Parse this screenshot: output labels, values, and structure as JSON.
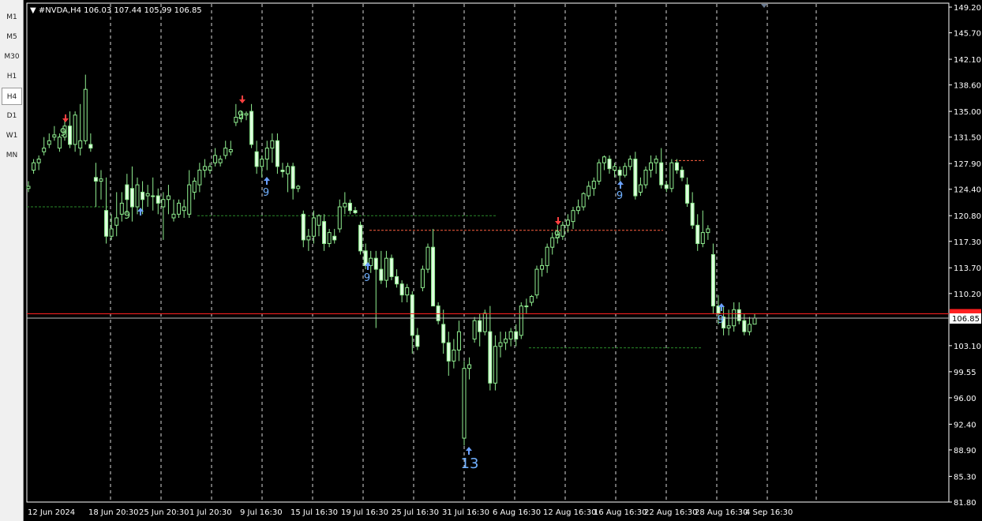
{
  "timeframes": [
    "M1",
    "M5",
    "M30",
    "H1",
    "H4",
    "D1",
    "W1",
    "MN"
  ],
  "active_timeframe": "H4",
  "header": {
    "text": "#NVDA,H4  106.03 107.44 105.99 106.85"
  },
  "chart_data": {
    "type": "candlestick",
    "symbol": "#NVDA",
    "timeframe": "H4",
    "ohlc_last": {
      "open": 106.03,
      "high": 107.44,
      "low": 105.99,
      "close": 106.85
    },
    "ylim": [
      81.8,
      149.2
    ],
    "y_ticks": [
      "149.20",
      "145.70",
      "142.10",
      "138.60",
      "135.00",
      "131.50",
      "127.90",
      "124.40",
      "120.80",
      "117.30",
      "113.70",
      "110.20",
      "103.10",
      "99.55",
      "96.00",
      "92.40",
      "88.90",
      "85.30",
      "81.80"
    ],
    "x_tick_labels": [
      "12 Jun 2024",
      "18 Jun 20:30",
      "25 Jun 20:30",
      "1 Jul 20:30",
      "9 Jul 16:30",
      "15 Jul 16:30",
      "19 Jul 16:30",
      "25 Jul 16:30",
      "31 Jul 16:30",
      "6 Aug 16:30",
      "12 Aug 16:30",
      "16 Aug 16:30",
      "22 Aug 16:30",
      "28 Aug 16:30",
      "4 Sep 16:30"
    ],
    "current_price_label": "106.85",
    "current_price": 106.85,
    "red_line_price": 107.44,
    "grid": "vertical dashed",
    "colors": {
      "bg": "#000000",
      "up": "#ffffff",
      "down": "#90ee90",
      "bull_body": "#e0ffe0",
      "axis": "#ffffff",
      "red_line": "#ff2020",
      "resistance": "#ff6040",
      "support": "#2a8a2a",
      "arrow_up": "#6aa0ff",
      "arrow_down": "#ff4040",
      "count_up": "#70b0ff"
    },
    "candles": [
      [
        124.5,
        125.5,
        124.0,
        124.8
      ],
      [
        127.0,
        128.5,
        126.5,
        128.0
      ],
      [
        128.0,
        129.0,
        127.0,
        128.5
      ],
      [
        129.5,
        131.5,
        129.0,
        130.0
      ],
      [
        130.5,
        132.0,
        130.0,
        131.0
      ],
      [
        131.5,
        133.0,
        131.0,
        131.8
      ],
      [
        130.0,
        132.0,
        129.5,
        131.5
      ],
      [
        131.5,
        134.0,
        131.0,
        133.0
      ],
      [
        133.0,
        135.0,
        130.0,
        130.5
      ],
      [
        130.5,
        135.0,
        129.5,
        134.5
      ],
      [
        130.0,
        136.0,
        129.0,
        131.0
      ],
      [
        131.0,
        140.0,
        130.5,
        138.0
      ],
      [
        130.5,
        132.0,
        129.5,
        130.0
      ],
      [
        126.0,
        128.0,
        122.0,
        125.5
      ],
      [
        125.5,
        127.0,
        123.0,
        125.8
      ],
      [
        121.5,
        126.0,
        117.0,
        118.0
      ],
      [
        118.0,
        121.0,
        117.5,
        119.0
      ],
      [
        119.5,
        124.0,
        118.0,
        120.5
      ],
      [
        121.0,
        124.0,
        120.0,
        122.5
      ],
      [
        125.0,
        126.5,
        121.0,
        123.0
      ],
      [
        124.5,
        127.5,
        120.0,
        122.0
      ],
      [
        122.0,
        126.0,
        121.0,
        125.0
      ],
      [
        124.0,
        125.5,
        121.0,
        123.0
      ],
      [
        123.5,
        125.0,
        122.0,
        123.8
      ],
      [
        123.5,
        126.0,
        121.5,
        123.5
      ],
      [
        123.5,
        124.5,
        121.0,
        122.5
      ],
      [
        122.0,
        124.0,
        117.5,
        123.0
      ],
      [
        123.0,
        125.0,
        121.0,
        123.5
      ],
      [
        120.5,
        123.0,
        120.0,
        121.0
      ],
      [
        121.0,
        123.0,
        120.5,
        122.5
      ],
      [
        121.5,
        123.0,
        120.5,
        122.0
      ],
      [
        121.0,
        127.0,
        120.5,
        125.0
      ],
      [
        124.0,
        126.0,
        123.0,
        125.5
      ],
      [
        125.0,
        128.0,
        124.0,
        127.0
      ],
      [
        127.0,
        128.5,
        126.0,
        127.5
      ],
      [
        127.0,
        128.0,
        126.5,
        127.5
      ],
      [
        128.0,
        130.0,
        127.5,
        129.0
      ],
      [
        128.0,
        129.0,
        127.5,
        128.5
      ],
      [
        129.0,
        131.0,
        128.5,
        130.0
      ],
      [
        129.5,
        131.0,
        129.0,
        129.8
      ],
      [
        133.5,
        136.0,
        133.0,
        134.2
      ],
      [
        134.0,
        135.0,
        133.5,
        134.5
      ],
      [
        134.5,
        135.0,
        133.8,
        134.7
      ],
      [
        135.0,
        136.0,
        130.0,
        130.5
      ],
      [
        129.5,
        131.0,
        126.5,
        127.5
      ],
      [
        127.5,
        129.0,
        126.0,
        128.5
      ],
      [
        128.5,
        131.0,
        127.0,
        130.0
      ],
      [
        130.0,
        132.0,
        128.0,
        131.0
      ],
      [
        131.0,
        132.0,
        126.5,
        127.5
      ],
      [
        127.0,
        128.0,
        126.0,
        126.8
      ],
      [
        126.5,
        128.0,
        124.0,
        127.5
      ],
      [
        127.5,
        128.0,
        123.0,
        124.5
      ],
      [
        124.5,
        125.0,
        124.0,
        124.8
      ],
      [
        121.0,
        121.5,
        116.5,
        117.5
      ],
      [
        117.5,
        119.0,
        116.0,
        118.0
      ],
      [
        118.0,
        121.5,
        117.0,
        120.5
      ],
      [
        119.5,
        121.0,
        118.0,
        120.8
      ],
      [
        120.0,
        121.0,
        116.0,
        117.0
      ],
      [
        117.0,
        119.0,
        116.5,
        118.5
      ],
      [
        118.0,
        119.0,
        117.0,
        117.5
      ],
      [
        119.0,
        123.0,
        118.5,
        122.0
      ],
      [
        122.0,
        124.0,
        121.0,
        122.5
      ],
      [
        122.5,
        123.0,
        121.0,
        121.5
      ],
      [
        121.5,
        122.0,
        121.0,
        121.2
      ],
      [
        119.5,
        120.0,
        115.5,
        116.0
      ],
      [
        116.0,
        117.0,
        113.5,
        114.0
      ],
      [
        114.0,
        116.0,
        113.0,
        115.0
      ],
      [
        115.0,
        116.0,
        105.5,
        113.5
      ],
      [
        113.5,
        116.0,
        111.5,
        112.0
      ],
      [
        112.0,
        116.0,
        111.0,
        115.0
      ],
      [
        115.0,
        115.5,
        112.0,
        112.5
      ],
      [
        112.5,
        113.5,
        111.0,
        111.5
      ],
      [
        111.5,
        112.0,
        109.0,
        110.0
      ],
      [
        110.0,
        111.5,
        109.0,
        111.0
      ],
      [
        110.0,
        110.5,
        102.0,
        104.5
      ],
      [
        104.5,
        105.5,
        102.5,
        103.0
      ],
      [
        111.0,
        114.0,
        110.5,
        113.5
      ],
      [
        113.5,
        117.0,
        113.0,
        116.5
      ],
      [
        116.5,
        119.0,
        115.5,
        108.5
      ],
      [
        108.5,
        109.0,
        106.0,
        106.5
      ],
      [
        106.0,
        108.0,
        102.0,
        103.5
      ],
      [
        103.5,
        105.0,
        99.0,
        101.0
      ],
      [
        101.0,
        104.0,
        100.0,
        102.5
      ],
      [
        102.5,
        106.5,
        101.0,
        105.0
      ],
      [
        90.5,
        101.0,
        89.5,
        100.0
      ],
      [
        100.0,
        101.5,
        98.5,
        100.5
      ],
      [
        104.0,
        107.0,
        103.5,
        106.5
      ],
      [
        106.5,
        107.5,
        103.0,
        105.0
      ],
      [
        105.0,
        108.0,
        104.5,
        107.5
      ],
      [
        105.0,
        108.5,
        97.0,
        98.0
      ],
      [
        98.0,
        104.5,
        97.0,
        103.0
      ],
      [
        103.0,
        105.0,
        101.5,
        103.5
      ],
      [
        103.5,
        105.0,
        102.5,
        104.0
      ],
      [
        104.0,
        105.5,
        103.0,
        105.0
      ],
      [
        105.0,
        106.0,
        103.0,
        104.0
      ],
      [
        104.5,
        109.0,
        104.0,
        108.5
      ],
      [
        108.5,
        109.5,
        107.5,
        108.5
      ],
      [
        109.0,
        110.0,
        108.5,
        109.8
      ],
      [
        110.0,
        114.0,
        109.5,
        113.5
      ],
      [
        113.5,
        115.0,
        112.5,
        114.0
      ],
      [
        114.0,
        117.0,
        113.0,
        116.5
      ],
      [
        116.5,
        118.5,
        115.5,
        117.8
      ],
      [
        117.8,
        119.5,
        117.0,
        118.2
      ],
      [
        118.0,
        120.0,
        117.5,
        119.5
      ],
      [
        119.5,
        121.0,
        118.5,
        120.2
      ],
      [
        120.0,
        122.0,
        119.0,
        121.5
      ],
      [
        121.5,
        123.0,
        121.0,
        122.0
      ],
      [
        122.0,
        124.0,
        121.5,
        123.8
      ],
      [
        123.5,
        125.5,
        123.0,
        124.8
      ],
      [
        124.5,
        126.0,
        123.5,
        125.5
      ],
      [
        125.5,
        128.5,
        125.0,
        128.0
      ],
      [
        128.0,
        129.0,
        127.0,
        128.8
      ],
      [
        128.5,
        129.0,
        126.5,
        127.2
      ],
      [
        127.0,
        128.0,
        126.0,
        127.5
      ],
      [
        127.0,
        127.5,
        125.5,
        126.3
      ],
      [
        126.3,
        128.0,
        126.0,
        127.5
      ],
      [
        127.5,
        129.0,
        127.0,
        128.5
      ],
      [
        128.5,
        129.5,
        123.0,
        123.5
      ],
      [
        124.0,
        126.0,
        123.5,
        125.0
      ],
      [
        125.0,
        127.5,
        124.5,
        127.0
      ],
      [
        127.0,
        129.0,
        126.0,
        128.0
      ],
      [
        128.0,
        129.0,
        126.5,
        128.5
      ],
      [
        128.0,
        130.0,
        124.5,
        125.0
      ],
      [
        125.0,
        125.5,
        124.0,
        124.5
      ],
      [
        124.5,
        128.5,
        124.0,
        128.0
      ],
      [
        128.0,
        128.5,
        126.5,
        127.0
      ],
      [
        127.0,
        127.5,
        125.5,
        126.0
      ],
      [
        125.0,
        126.0,
        122.0,
        122.5
      ],
      [
        122.5,
        124.0,
        119.0,
        119.5
      ],
      [
        119.5,
        121.0,
        116.0,
        117.0
      ],
      [
        117.0,
        121.5,
        116.5,
        118.5
      ],
      [
        118.5,
        119.5,
        117.5,
        119.0
      ],
      [
        115.5,
        117.0,
        107.5,
        108.5
      ],
      [
        108.5,
        110.0,
        106.0,
        107.5
      ],
      [
        107.0,
        108.5,
        104.5,
        105.5
      ],
      [
        105.5,
        108.0,
        104.5,
        105.8
      ],
      [
        105.8,
        109.0,
        105.0,
        108.0
      ],
      [
        108.0,
        109.0,
        106.0,
        106.5
      ],
      [
        106.5,
        107.5,
        104.5,
        105.0
      ],
      [
        105.0,
        107.0,
        104.5,
        106.0
      ],
      [
        106.03,
        107.44,
        105.99,
        106.85
      ]
    ]
  }
}
